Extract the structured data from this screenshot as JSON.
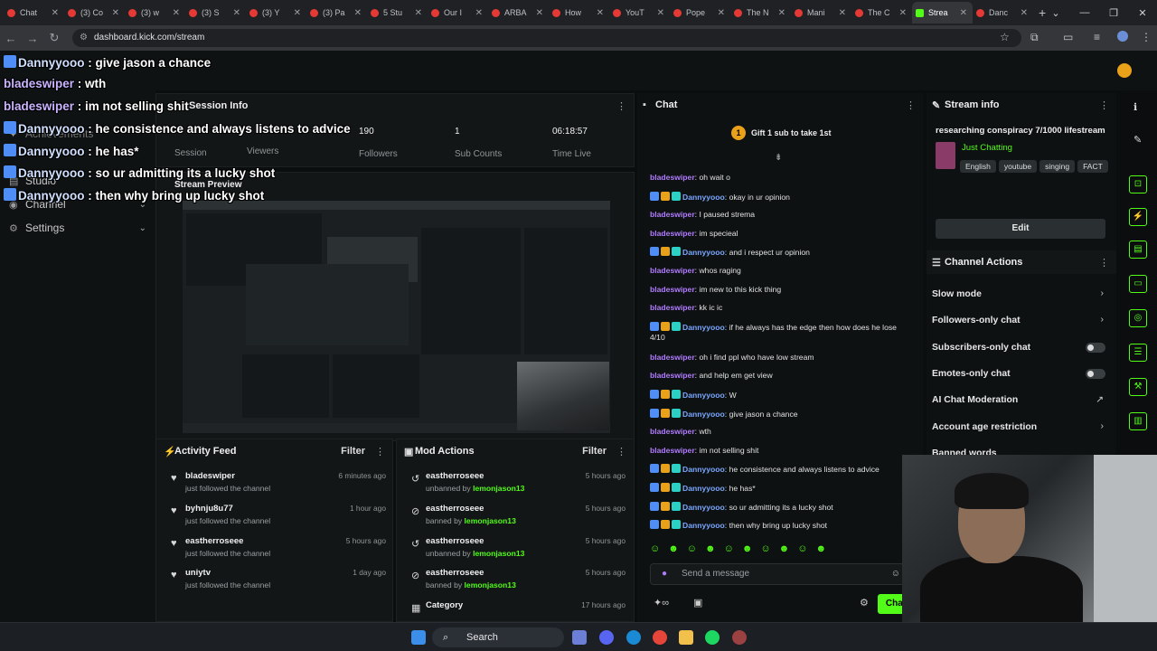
{
  "browser": {
    "tabs": [
      "Chat",
      "(3) Co",
      "(3) w",
      "(3) S",
      "(3) Y",
      "(3) Pa",
      "5 Stu",
      "Our I",
      "ARBA",
      "How",
      "YouT",
      "Pope",
      "The N",
      "Mani",
      "The C",
      "Strea",
      "Danc"
    ],
    "url": "dashboard.kick.com/stream"
  },
  "sidebar": {
    "achievements": "Achievements",
    "studio": "Studio",
    "channel": "Channel",
    "settings": "Settings"
  },
  "session": {
    "title": "Session Info",
    "stats": [
      {
        "value": "190",
        "label": "Followers"
      },
      {
        "value": "1",
        "label": "Sub Counts"
      },
      {
        "value": "06:18:57",
        "label": "Time Live"
      }
    ],
    "viewers_label": "Viewers",
    "session_label": "Session",
    "preview_title": "Stream Preview"
  },
  "overlay_chat": [
    {
      "user": "Dannyyooo",
      "text": "give jason a chance"
    },
    {
      "user": "bladeswiper",
      "text": "wth"
    },
    {
      "user": "bladeswiper",
      "text": "im not selling shit"
    },
    {
      "user": "Dannyyooo",
      "text": "he consistence and always listens to advice"
    },
    {
      "user": "Dannyyooo",
      "text": "he has*"
    },
    {
      "user": "Dannyyooo",
      "text": "so ur admitting its a lucky shot"
    },
    {
      "user": "Dannyyooo",
      "text": "then why bring up lucky shot"
    }
  ],
  "chat": {
    "title": "Chat",
    "gift_banner": "Gift 1 sub to take 1st",
    "gift_count": "1",
    "messages": [
      {
        "user": "bladeswiper",
        "text": "oh wait o",
        "badges": false
      },
      {
        "user": "Dannyyooo",
        "text": "okay in ur opinion",
        "badges": true
      },
      {
        "user": "bladeswiper",
        "text": "I paused strema",
        "badges": false
      },
      {
        "user": "bladeswiper",
        "text": "im specieal",
        "badges": false
      },
      {
        "user": "Dannyyooo",
        "text": "and i respect ur opinion",
        "badges": true
      },
      {
        "user": "bladeswiper",
        "text": "whos raging",
        "badges": false
      },
      {
        "user": "bladeswiper",
        "text": "im new to this kick thing",
        "badges": false
      },
      {
        "user": "bladeswiper",
        "text": "kk ic ic",
        "badges": false
      },
      {
        "user": "Dannyyooo",
        "text": "if he always has the edge then how does he lose 4/10",
        "badges": true
      },
      {
        "user": "bladeswiper",
        "text": "oh i find ppl who have low stream",
        "badges": false
      },
      {
        "user": "bladeswiper",
        "text": "and help em get view",
        "badges": false
      },
      {
        "user": "Dannyyooo",
        "text": "W",
        "badges": true
      },
      {
        "user": "Dannyyooo",
        "text": "give jason a chance",
        "badges": true
      },
      {
        "user": "bladeswiper",
        "text": "wth",
        "badges": false
      },
      {
        "user": "bladeswiper",
        "text": "im not selling shit",
        "badges": false
      },
      {
        "user": "Dannyyooo",
        "text": "he consistence and always listens to advice",
        "badges": true
      },
      {
        "user": "Dannyyooo",
        "text": "he has*",
        "badges": true
      },
      {
        "user": "Dannyyooo",
        "text": "so ur admitting its a lucky shot",
        "badges": true
      },
      {
        "user": "Dannyyooo",
        "text": "then why bring up lucky shot",
        "badges": true
      }
    ],
    "input_placeholder": "Send a message",
    "send_label": "Chat"
  },
  "stream_info": {
    "title": "Stream info",
    "stream_title": "researching conspiracy 7/1000 lifestream",
    "category": "Just Chatting",
    "tags": [
      "English",
      "youtube",
      "singing",
      "FACT"
    ],
    "edit_label": "Edit"
  },
  "channel_actions": {
    "title": "Channel Actions",
    "items": [
      "Slow mode",
      "Followers-only chat",
      "Subscribers-only chat",
      "Emotes-only chat",
      "AI Chat Moderation",
      "Account age restriction",
      "Banned words"
    ]
  },
  "activity_feed": {
    "title": "Activity Feed",
    "filter_label": "Filter",
    "items": [
      {
        "name": "bladeswiper",
        "action": "just followed the channel",
        "time": "6 minutes ago"
      },
      {
        "name": "byhnju8u77",
        "action": "just followed the channel",
        "time": "1 hour ago"
      },
      {
        "name": "eastherroseee",
        "action": "just followed the channel",
        "time": "5 hours ago"
      },
      {
        "name": "uniytv",
        "action": "just followed the channel",
        "time": "1 day ago"
      }
    ]
  },
  "mod_actions": {
    "title": "Mod Actions",
    "filter_label": "Filter",
    "items": [
      {
        "name": "eastherroseee",
        "action": "unbanned by",
        "by": "lemonjason13",
        "time": "5 hours ago"
      },
      {
        "name": "eastherroseee",
        "action": "banned by",
        "by": "lemonjason13",
        "time": "5 hours ago"
      },
      {
        "name": "eastherroseee",
        "action": "unbanned by",
        "by": "lemonjason13",
        "time": "5 hours ago"
      },
      {
        "name": "eastherroseee",
        "action": "banned by",
        "by": "lemonjason13",
        "time": "5 hours ago"
      }
    ],
    "category_label": "Category",
    "category_time": "17 hours ago"
  },
  "taskbar": {
    "search": "Search"
  },
  "colors": {
    "accent": "#53fc18",
    "bladeswiper": "#b07cff",
    "dannyyooo": "#7aa7ff"
  }
}
